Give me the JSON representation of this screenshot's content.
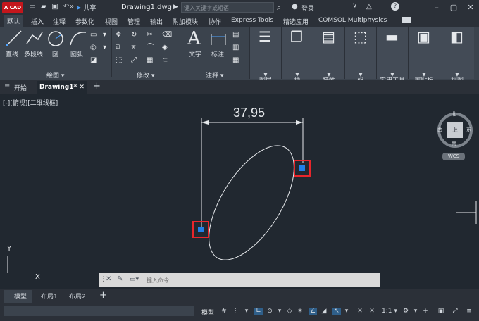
{
  "app": {
    "logo_text": "A CAD",
    "document_title": "Drawing1.dwg",
    "share_label": "共享",
    "search_placeholder": "键入关键字或短语",
    "login_label": "登录"
  },
  "ribbon_tabs": [
    "默认",
    "插入",
    "注释",
    "参数化",
    "视图",
    "管理",
    "输出",
    "附加模块",
    "协作",
    "Express Tools",
    "精选应用",
    "COMSOL Multiphysics"
  ],
  "ribbon": {
    "draw": {
      "title": "绘图",
      "tools": [
        "直线",
        "多段线",
        "圆",
        "圆弧"
      ]
    },
    "modify": {
      "title": "修改"
    },
    "annotation": {
      "title": "注释",
      "tools": [
        "文字",
        "标注"
      ]
    },
    "big_tools": [
      "图层",
      "块",
      "特性",
      "组",
      "实用工具",
      "剪贴板",
      "视图"
    ]
  },
  "doc_tabs": {
    "start": "开始",
    "active": "Drawing1*"
  },
  "viewport": {
    "label": "[-][俯视][二维线框]",
    "dimension_value": "37,95",
    "compass": {
      "north": "北",
      "south": "南",
      "east": "东",
      "west": "西",
      "center": "上",
      "wcs": "WCS"
    },
    "ucs_x": "X",
    "ucs_y": "Y"
  },
  "command_line": {
    "placeholder": "键入命令"
  },
  "layout_tabs": [
    "模型",
    "布局1",
    "布局2"
  ],
  "status": {
    "model": "模型",
    "scale": "1:1"
  },
  "colors": {
    "background": "#212830",
    "ribbon": "#3b434d",
    "accent_red": "#e8262b",
    "grip_blue": "#1f7fe8",
    "logo": "#c4161c"
  }
}
